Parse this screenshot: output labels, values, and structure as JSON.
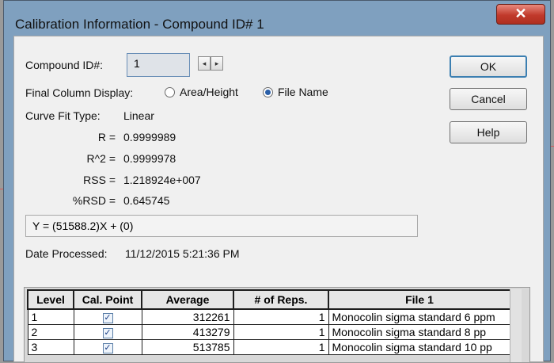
{
  "window": {
    "title": "Calibration Information - Compound ID# 1",
    "close_glyph": "✕"
  },
  "compound": {
    "label": "Compound ID#:",
    "value": "1",
    "prev_glyph": "◂",
    "next_glyph": "▸"
  },
  "final_column": {
    "label": "Final Column Display:",
    "options": [
      {
        "label": "Area/Height",
        "selected": false
      },
      {
        "label": "File Name",
        "selected": true
      }
    ]
  },
  "curve_fit": {
    "label": "Curve Fit Type:",
    "value": "Linear"
  },
  "stats": [
    {
      "label": "R =",
      "value": "0.9999989"
    },
    {
      "label": "R^2 =",
      "value": "0.9999978"
    },
    {
      "label": "RSS =",
      "value": "1.218924e+007"
    },
    {
      "label": "%RSD =",
      "value": "0.645745"
    }
  ],
  "equation": "Y = (51588.2)X + (0)",
  "date_processed": {
    "label": "Date Processed:",
    "value": "11/12/2015 5:21:36 PM"
  },
  "buttons": {
    "ok": "OK",
    "cancel": "Cancel",
    "help": "Help"
  },
  "table": {
    "headers": [
      "Level",
      "Cal. Point",
      "Average",
      "# of Reps.",
      "File 1"
    ],
    "rows": [
      {
        "level": "1",
        "checked": true,
        "check_glyph": "✓",
        "average": "312261",
        "reps": "1",
        "file": "Monocolin sigma  standard 6 ppm"
      },
      {
        "level": "2",
        "checked": true,
        "check_glyph": "✓",
        "average": "413279",
        "reps": "1",
        "file": "Monocolin sigma  standard 8  pp"
      },
      {
        "level": "3",
        "checked": true,
        "check_glyph": "✓",
        "average": "513785",
        "reps": "1",
        "file": "Monocolin sigma  standard 10  pp"
      }
    ]
  }
}
